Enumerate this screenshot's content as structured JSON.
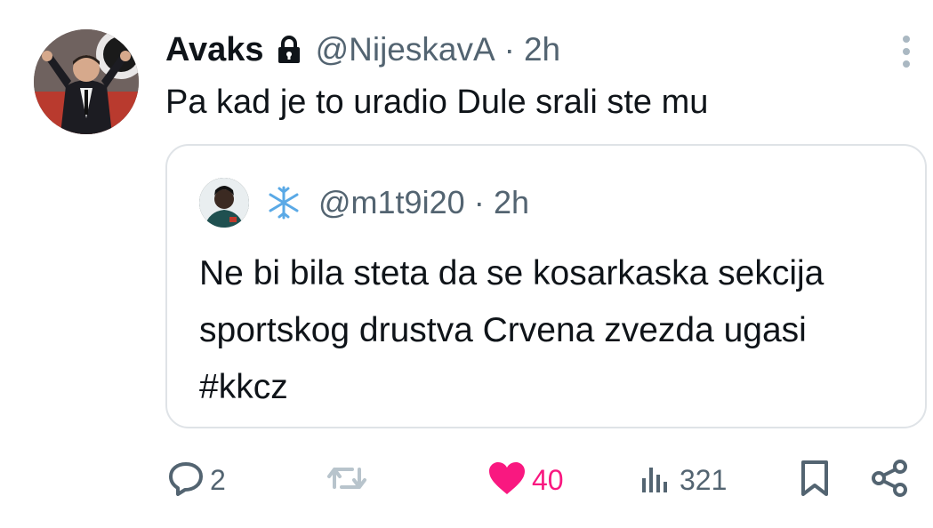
{
  "tweet": {
    "author_name": "Avaks",
    "handle": "@NijeskavA",
    "separator": "·",
    "time": "2h",
    "text": "Pa kad je to uradio Dule srali ste mu",
    "protected": true
  },
  "quote": {
    "emoji": "snowflake",
    "handle": "@m1t9i20",
    "separator": "·",
    "time": "2h",
    "text": "Ne bi bila steta da se kosarkaska sekcija sportskog drustva Crvena zvezda ugasi #kkcz"
  },
  "actions": {
    "replies": "2",
    "retweets": "",
    "likes": "40",
    "views": "321"
  },
  "colors": {
    "text": "#0f1419",
    "muted": "#536471",
    "like": "#f91880",
    "border": "#dfe3e7"
  },
  "icons": [
    "lock-icon",
    "more-vertical-icon",
    "snowflake-icon",
    "reply-icon",
    "retweet-icon",
    "heart-icon",
    "views-icon",
    "bookmark-icon",
    "share-icon"
  ]
}
